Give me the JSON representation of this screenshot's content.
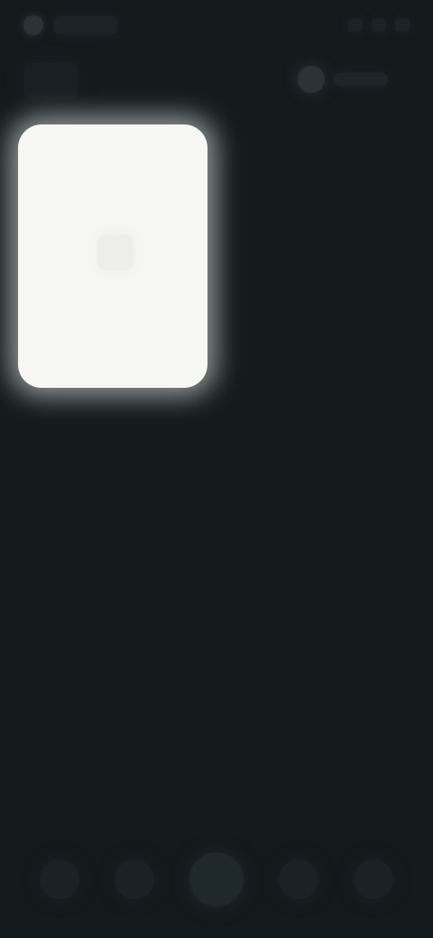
{
  "colors": {
    "background": "#141b1d",
    "card": "#f6f6f4",
    "nav_background": "#131a1c"
  },
  "icons": {
    "status_left": "status-dot-icon",
    "top_action": "circle-icon",
    "nav": [
      "nav-icon-1",
      "nav-icon-2",
      "nav-icon-3",
      "nav-icon-4",
      "nav-icon-5"
    ]
  }
}
